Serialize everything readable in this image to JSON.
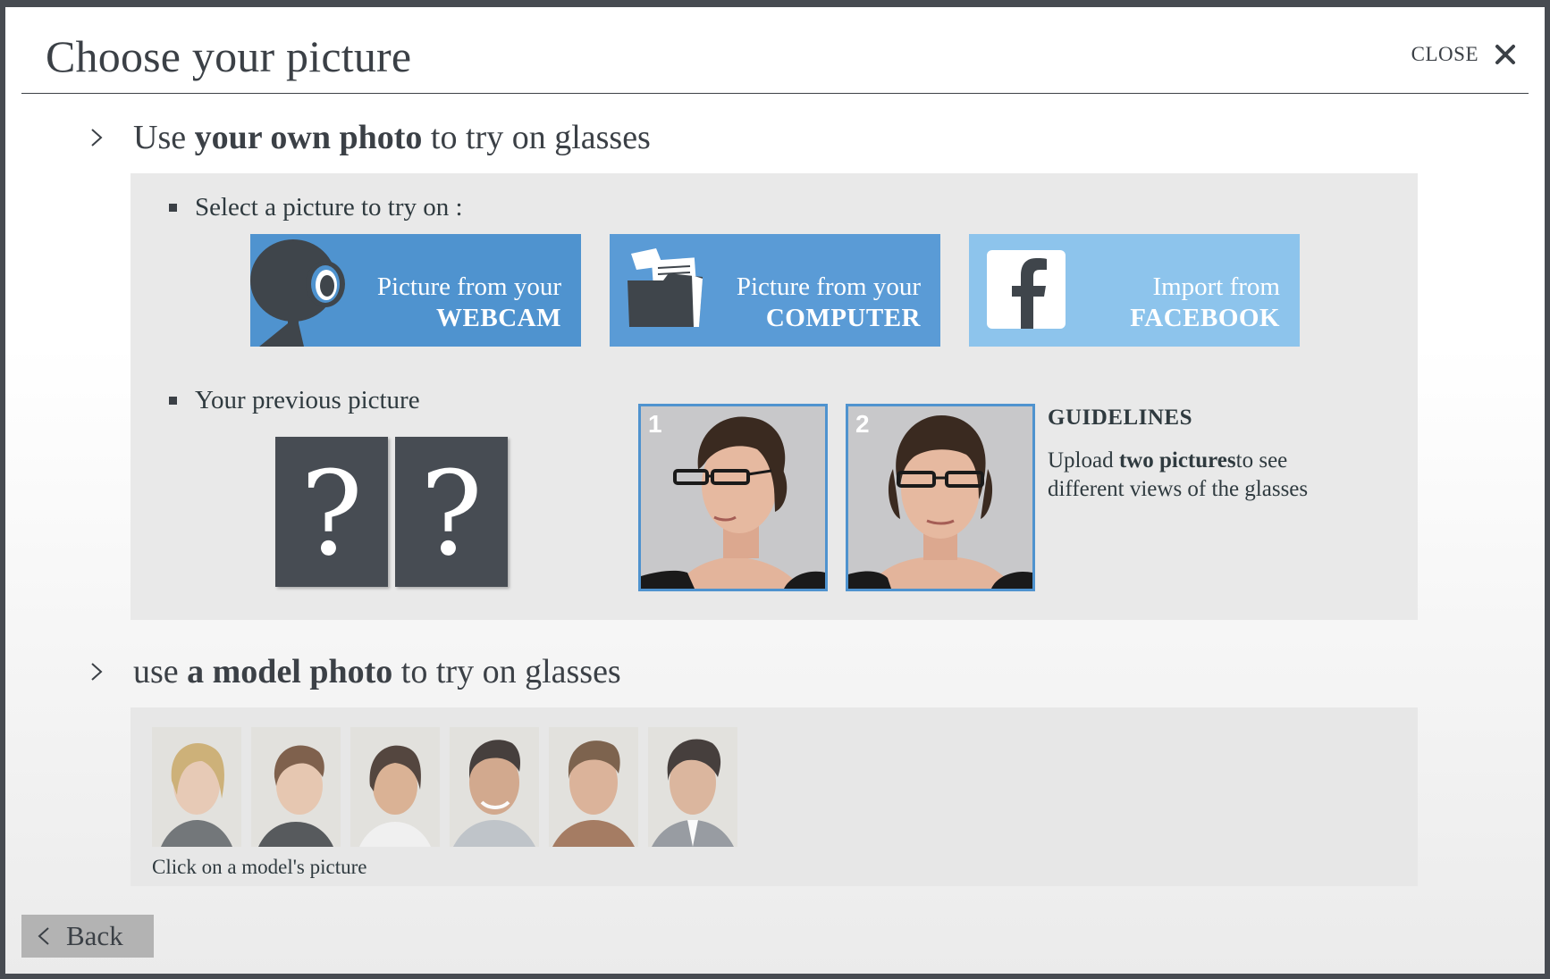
{
  "dialog": {
    "title": "Choose your picture",
    "close_label": "CLOSE"
  },
  "section_own": {
    "prefix": "Use ",
    "bold": "your own photo",
    "suffix": " to try on glasses",
    "select_label": "Select a picture to try on :",
    "sources": [
      {
        "line1": "Picture from your",
        "line2": "WEBCAM",
        "icon": "webcam-icon"
      },
      {
        "line1": "Picture from your",
        "line2": "COMPUTER",
        "icon": "folder-icon"
      },
      {
        "line1": "Import from",
        "line2": "FACEBOOK",
        "icon": "facebook-icon"
      }
    ],
    "previous_label": "Your previous picture",
    "previous_placeholders": [
      "?",
      "?"
    ],
    "examples": [
      "1",
      "2"
    ],
    "guidelines_title": "GUIDELINES",
    "guidelines_prefix": "Upload ",
    "guidelines_bold": "two pictures",
    "guidelines_suffix": "to see different views of the glasses"
  },
  "section_model": {
    "prefix": "use ",
    "bold": "a model photo",
    "suffix": " to try on glasses",
    "caption": "Click on a model's picture"
  },
  "footer": {
    "back_label": "Back"
  },
  "colors": {
    "webcam_button": "#4f93cf",
    "computer_button": "#5a9bd6",
    "facebook_button": "#8dc4ec",
    "panel_bg": "#e9e9e9",
    "text_dark": "#3b4046"
  }
}
